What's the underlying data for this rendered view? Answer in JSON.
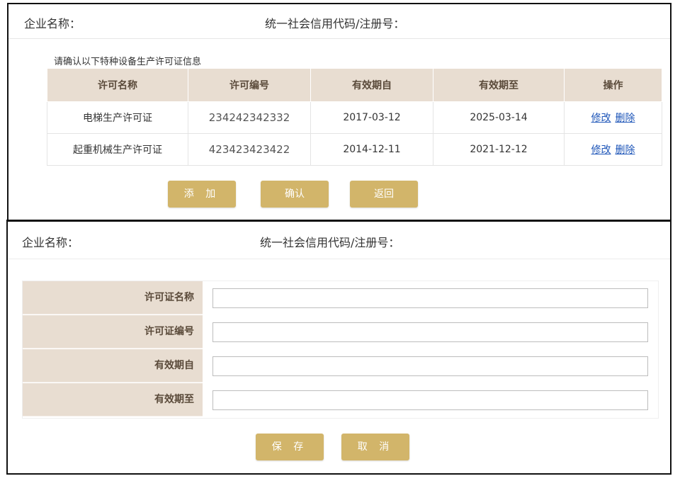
{
  "top_panel": {
    "company_label": "企业名称：",
    "credit_label": "统一社会信用代码/注册号：",
    "section_title": "请确认以下特种设备生产许可证信息",
    "table": {
      "headers": [
        "许可名称",
        "许可编号",
        "有效期自",
        "有效期至",
        "操作"
      ],
      "rows": [
        {
          "name": "电梯生产许可证",
          "number": "234242342332",
          "valid_from": "2017-03-12",
          "valid_to": "2025-03-14",
          "edit": "修改",
          "delete": "删除"
        },
        {
          "name": "起重机械生产许可证",
          "number": "423423423422",
          "valid_from": "2014-12-11",
          "valid_to": "2021-12-12",
          "edit": "修改",
          "delete": "删除"
        }
      ]
    },
    "buttons": {
      "add": "添 加",
      "confirm": "确认",
      "back": "返回"
    }
  },
  "bottom_panel": {
    "company_label": "企业名称：",
    "credit_label": "统一社会信用代码/注册号：",
    "form": {
      "fields": [
        {
          "label": "许可证名称",
          "value": ""
        },
        {
          "label": "许可证编号",
          "value": ""
        },
        {
          "label": "有效期自",
          "value": ""
        },
        {
          "label": "有效期至",
          "value": ""
        }
      ]
    },
    "buttons": {
      "save": "保 存",
      "cancel": "取 消"
    }
  },
  "colors": {
    "accent": "#d2b56a",
    "header_bg": "#e8ddd1",
    "link": "#1d55b8"
  }
}
